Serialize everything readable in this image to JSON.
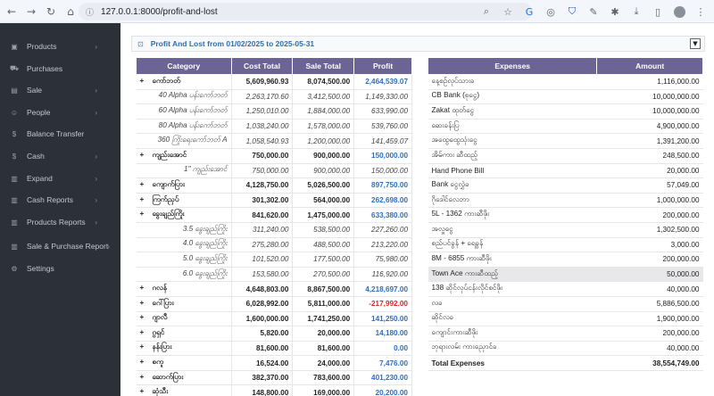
{
  "browser": {
    "url": "127.0.0.1:8000/profit-and-lost"
  },
  "sidebar": {
    "items": [
      {
        "label": "Products",
        "icon": "cube-icon",
        "chevron": true
      },
      {
        "label": "Purchases",
        "icon": "cart-icon",
        "chevron": false
      },
      {
        "label": "Sale",
        "icon": "cash-register-icon",
        "chevron": true
      },
      {
        "label": "People",
        "icon": "people-icon",
        "chevron": true
      },
      {
        "label": "Balance Transfer",
        "icon": "dollar-icon",
        "chevron": false
      },
      {
        "label": "Cash",
        "icon": "dollar-icon",
        "chevron": true
      },
      {
        "label": "Expand",
        "icon": "chart-icon",
        "chevron": true
      },
      {
        "label": "Cash Reports",
        "icon": "chart-icon",
        "chevron": true
      },
      {
        "label": "Products Reports",
        "icon": "chart-icon",
        "chevron": true
      },
      {
        "label": "Sale & Purchase Report",
        "icon": "chart-icon",
        "chevron": true
      },
      {
        "label": "Settings",
        "icon": "gear-icon",
        "chevron": false
      }
    ]
  },
  "header": {
    "title": "Profit And Lost  from 01/02/2025 to 2025-05-31"
  },
  "pl_table": {
    "columns": [
      "Category",
      "Cost Total",
      "Sale Total",
      "Profit"
    ],
    "rows": [
      {
        "type": "group",
        "category": "ကော်ဘတ်",
        "cost": "5,609,960.93",
        "sale": "8,074,500.00",
        "profit": "2,464,539.07",
        "sign": "pos"
      },
      {
        "type": "sub",
        "category": "40 Alpha ပန်းကော်ဘတ်",
        "cost": "2,263,170.60",
        "sale": "3,412,500.00",
        "profit": "1,149,330.00",
        "sign": "pos"
      },
      {
        "type": "sub",
        "category": "60 Alpha ပန်းကော်ဘတ်",
        "cost": "1,250,010.00",
        "sale": "1,884,000.00",
        "profit": "633,990.00",
        "sign": "pos"
      },
      {
        "type": "sub",
        "category": "80 Alpha ပန်းကော်ဘတ်",
        "cost": "1,038,240.00",
        "sale": "1,578,000.00",
        "profit": "539,760.00",
        "sign": "pos"
      },
      {
        "type": "sub",
        "category": "360 ကြိုးရေးကော်ဘတ် A",
        "cost": "1,058,540.93",
        "sale": "1,200,000.00",
        "profit": "141,459.07",
        "sign": "pos"
      },
      {
        "type": "group",
        "category": "ကျည်းအောင်",
        "cost": "750,000.00",
        "sale": "900,000.00",
        "profit": "150,000.00",
        "sign": "pos"
      },
      {
        "type": "sub",
        "category": "1\" ကျည်းအောင်",
        "cost": "750,000.00",
        "sale": "900,000.00",
        "profit": "150,000.00",
        "sign": "pos"
      },
      {
        "type": "group",
        "category": "ကျောက်ပြား",
        "cost": "4,128,750.00",
        "sale": "5,026,500.00",
        "profit": "897,750.00",
        "sign": "pos"
      },
      {
        "type": "group",
        "category": "ကြက်ညှပ်",
        "cost": "301,302.00",
        "sale": "564,000.00",
        "profit": "262,698.00",
        "sign": "pos"
      },
      {
        "type": "group",
        "category": "ခွေးချည်ကြိုး",
        "cost": "841,620.00",
        "sale": "1,475,000.00",
        "profit": "633,380.00",
        "sign": "pos"
      },
      {
        "type": "sub",
        "category": "3.5 ခွေးချည်ကြိုး",
        "cost": "311,240.00",
        "sale": "538,500.00",
        "profit": "227,260.00",
        "sign": "pos"
      },
      {
        "type": "sub",
        "category": "4.0 ခွေးချည်ကြိုး",
        "cost": "275,280.00",
        "sale": "488,500.00",
        "profit": "213,220.00",
        "sign": "pos"
      },
      {
        "type": "sub",
        "category": "5.0 ခွေးချည်ကြိုး",
        "cost": "101,520.00",
        "sale": "177,500.00",
        "profit": "75,980.00",
        "sign": "pos"
      },
      {
        "type": "sub",
        "category": "6.0 ခွေးချည်ကြိုး",
        "cost": "153,580.00",
        "sale": "270,500.00",
        "profit": "116,920.00",
        "sign": "pos"
      },
      {
        "type": "group",
        "category": "ဂလန်",
        "cost": "4,648,803.00",
        "sale": "8,867,500.00",
        "profit": "4,218,697.00",
        "sign": "pos"
      },
      {
        "type": "group",
        "category": "ဂေါ်ပြား",
        "cost": "6,028,992.00",
        "sale": "5,811,000.00",
        "profit": "-217,992.00",
        "sign": "neg"
      },
      {
        "type": "group",
        "category": "ဂျာလီ",
        "cost": "1,600,000.00",
        "sale": "1,741,250.00",
        "profit": "141,250.00",
        "sign": "pos"
      },
      {
        "type": "group",
        "category": "ဂွရှင်",
        "cost": "5,820.00",
        "sale": "20,000.00",
        "profit": "14,180.00",
        "sign": "pos"
      },
      {
        "type": "group",
        "category": "နန်းပြား",
        "cost": "81,600.00",
        "sale": "81,600.00",
        "profit": "0.00",
        "sign": "pos"
      },
      {
        "type": "group",
        "category": "စကူ",
        "cost": "16,524.00",
        "sale": "24,000.00",
        "profit": "7,476.00",
        "sign": "pos"
      },
      {
        "type": "group",
        "category": "ဆောက်ပြား",
        "cost": "382,370.00",
        "sale": "783,600.00",
        "profit": "401,230.00",
        "sign": "pos"
      },
      {
        "type": "group",
        "category": "ဆုံသီး",
        "cost": "148,800.00",
        "sale": "169,000.00",
        "profit": "20,200.00",
        "sign": "pos"
      }
    ]
  },
  "ex_table": {
    "columns": [
      "Expenses",
      "Amount"
    ],
    "rows": [
      {
        "name": "နေ့စဉ်လုပ်သားခ",
        "amount": "1,116,000.00"
      },
      {
        "name": "CB Bank (စုငွေ)",
        "amount": "10,000,000.00"
      },
      {
        "name": "Zakat ထုတ်ငွေ",
        "amount": "10,000,000.00"
      },
      {
        "name": "ဆေးခန်းပြ",
        "amount": "4,900,000.00"
      },
      {
        "name": "အထွေထွေသုံးငွေ",
        "amount": "1,391,200.00"
      },
      {
        "name": "အိမ်ကား ဆီထည့်",
        "amount": "248,500.00"
      },
      {
        "name": "Hand Phone Bill",
        "amount": "20,000.00"
      },
      {
        "name": "Bank ငွေလွှဲခ",
        "amount": "57,049.00"
      },
      {
        "name": "ဂိုဒေါင်လေဘာ",
        "amount": "1,000,000.00"
      },
      {
        "name": "5L - 1362 ကားဆီဖိုး",
        "amount": "200,000.00"
      },
      {
        "name": "အလှူငွေ",
        "amount": "1,302,500.00"
      },
      {
        "name": "စည်ပင်ခွန် + ရေခွန်",
        "amount": "3,000.00"
      },
      {
        "name": "8M - 6855 ကားဆီဖိုး",
        "amount": "200,000.00"
      },
      {
        "name": "Town Ace ကားဆီထည့်",
        "amount": "50,000.00",
        "highlight": true
      },
      {
        "name": "138 ဆိုင်လုပ်ငန်းလိုင်စင်ဖိုး",
        "amount": "40,000.00"
      },
      {
        "name": "လခ",
        "amount": "5,886,500.00"
      },
      {
        "name": "ဆိုင်လခ",
        "amount": "1,900,000.00"
      },
      {
        "name": "ကျောင်းကားဆီဖိုး",
        "amount": "200,000.00"
      },
      {
        "name": "ဘုရားလမ်း ကားညှောင်ခ",
        "amount": "40,000.00"
      }
    ],
    "total_label": "Total Expenses",
    "total_amount": "38,554,749.00"
  }
}
